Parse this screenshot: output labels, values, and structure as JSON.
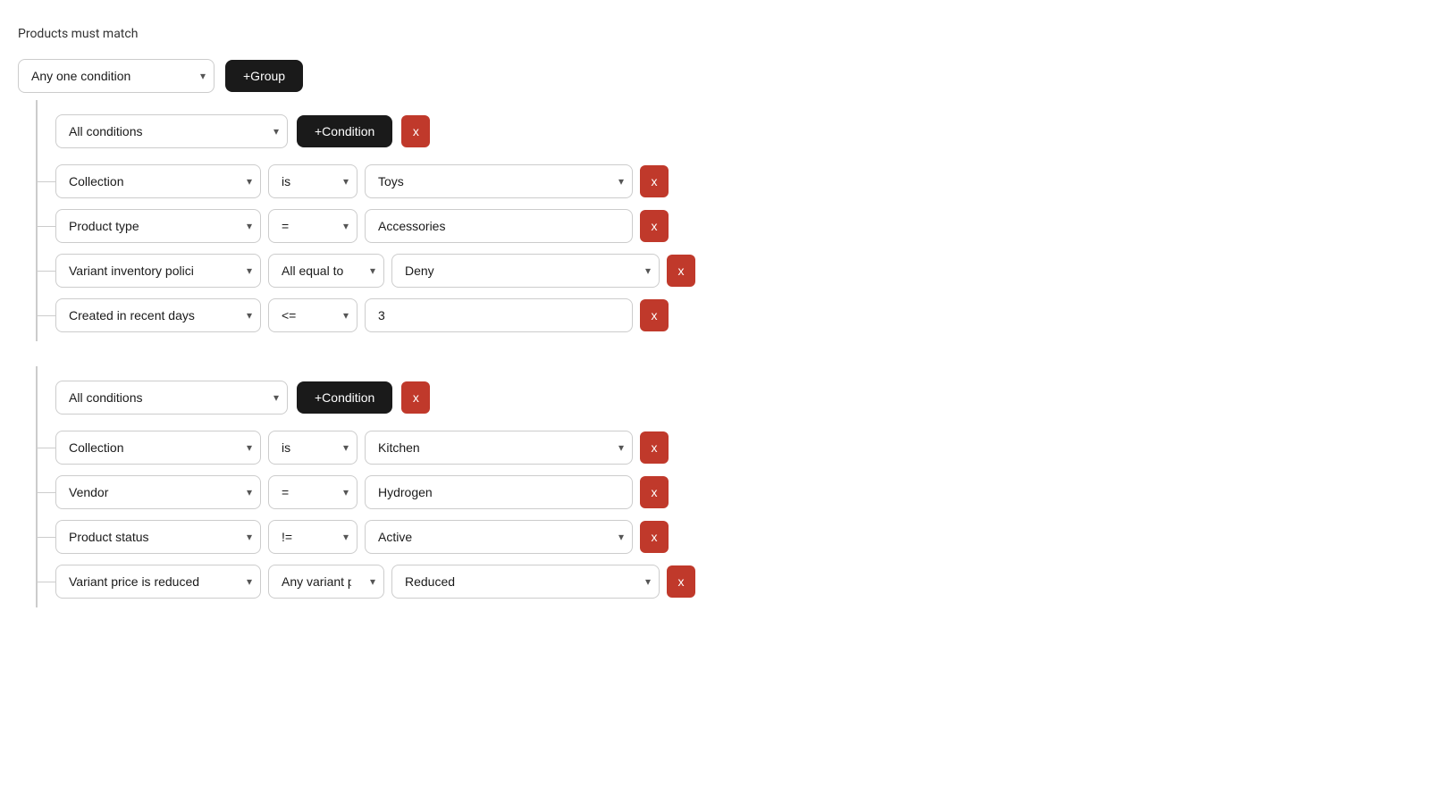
{
  "page": {
    "title": "Products must match"
  },
  "top": {
    "match_select": "Any one condition",
    "add_group_btn": "+Group"
  },
  "groups": [
    {
      "id": "group1",
      "match_select": "All conditions",
      "add_condition_btn": "+Condition",
      "remove_btn": "x",
      "conditions": [
        {
          "field": "Collection",
          "operator": "is",
          "value_type": "select",
          "value": "Toys",
          "remove_btn": "x"
        },
        {
          "field": "Product type",
          "operator": "=",
          "value_type": "input",
          "value": "Accessories",
          "remove_btn": "x"
        },
        {
          "field": "Variant inventory polici",
          "operator": "All equal to",
          "value_type": "select",
          "value": "Deny",
          "remove_btn": "x"
        },
        {
          "field": "Created in recent days",
          "operator": "<=",
          "value_type": "input",
          "value": "3",
          "remove_btn": "x"
        }
      ]
    },
    {
      "id": "group2",
      "match_select": "All conditions",
      "add_condition_btn": "+Condition",
      "remove_btn": "x",
      "conditions": [
        {
          "field": "Collection",
          "operator": "is",
          "value_type": "select",
          "value": "Kitchen",
          "remove_btn": "x"
        },
        {
          "field": "Vendor",
          "operator": "=",
          "value_type": "input",
          "value": "Hydrogen",
          "remove_btn": "x"
        },
        {
          "field": "Product status",
          "operator": "!=",
          "value_type": "select",
          "value": "Active",
          "remove_btn": "x"
        },
        {
          "field": "Variant price is reduced",
          "operator": "Any variant price is",
          "value_type": "select",
          "value": "Reduced",
          "remove_btn": "x"
        }
      ]
    }
  ]
}
